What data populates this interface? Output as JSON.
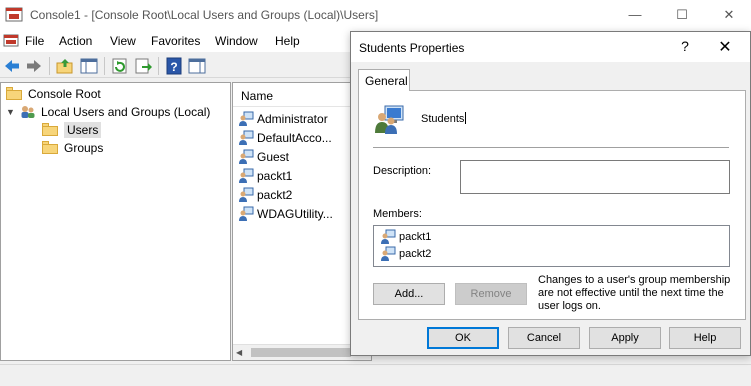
{
  "window": {
    "title": "Console1 - [Console Root\\Local Users and Groups (Local)\\Users]",
    "minimize_glyph": "—",
    "maximize_glyph": "☐",
    "close_glyph": "✕"
  },
  "menu": [
    "File",
    "Action",
    "View",
    "Favorites",
    "Window",
    "Help"
  ],
  "toolbar_icons": [
    "back-icon",
    "forward-icon",
    "up-folder-icon",
    "show-hide-tree-icon",
    "refresh-icon",
    "export-list-icon",
    "help-icon",
    "action-pane-icon"
  ],
  "tree": {
    "root": "Console Root",
    "lusrmgr": "Local Users and Groups (Local)",
    "users": "Users",
    "groups": "Groups"
  },
  "list": {
    "header": "Name",
    "items": [
      "Administrator",
      "DefaultAcco...",
      "Guest",
      "packt1",
      "packt2",
      "WDAGUtility..."
    ]
  },
  "dialog": {
    "title": "Students Properties",
    "help_glyph": "?",
    "close_glyph": "✕",
    "tab": "General",
    "group_name": "Students",
    "description_label": "Description:",
    "description_value": "",
    "members_label": "Members:",
    "members": [
      "packt1",
      "packt2"
    ],
    "add_button": "Add...",
    "remove_button": "Remove",
    "note": "Changes to a user's group membership are not effective until the next time the user logs on.",
    "ok": "OK",
    "cancel": "Cancel",
    "apply": "Apply",
    "help": "Help"
  },
  "colors": {
    "accent": "#0078d7",
    "folder": "#f7d57a"
  }
}
